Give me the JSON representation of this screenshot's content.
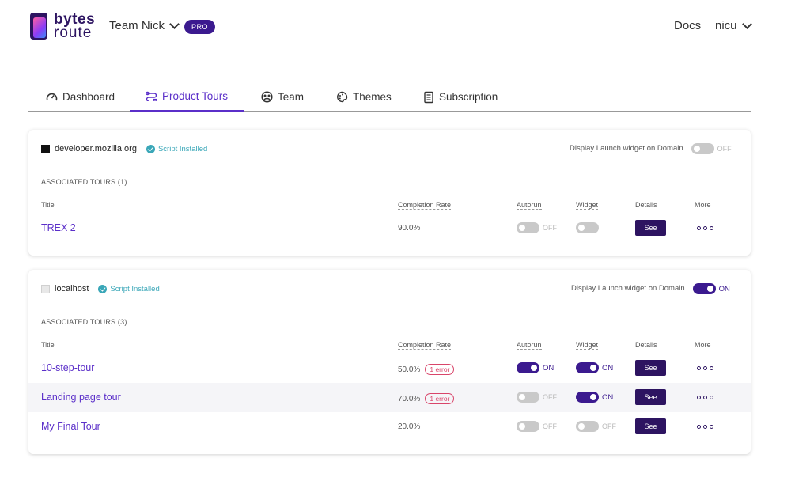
{
  "header": {
    "logo_top": "bytes",
    "logo_bottom": "route",
    "team": "Team Nick",
    "plan_badge": "PRO",
    "docs_link": "Docs",
    "user_name": "nicu"
  },
  "tabs": [
    {
      "label": "Dashboard",
      "icon": "gauge-icon"
    },
    {
      "label": "Product Tours",
      "icon": "route-icon",
      "active": true
    },
    {
      "label": "Team",
      "icon": "team-icon"
    },
    {
      "label": "Themes",
      "icon": "palette-icon"
    },
    {
      "label": "Subscription",
      "icon": "receipt-icon"
    }
  ],
  "table_headers": {
    "title": "Title",
    "completion_rate": "Completion Rate",
    "autorun": "Autorun",
    "widget": "Widget",
    "details": "Details",
    "more": "More"
  },
  "domains": [
    {
      "name": "developer.mozilla.org",
      "status": "Script Installed",
      "launch_label": "Display Launch widget on Domain",
      "launch_state": "OFF",
      "associated": "ASSOCIATED TOURS (1)",
      "tours": [
        {
          "title": "TREX 2",
          "rate": "90.0%",
          "error": "",
          "autorun": "OFF",
          "widget": "",
          "details": "See"
        }
      ]
    },
    {
      "name": "localhost",
      "status": "Script Installed",
      "launch_label": "Display Launch widget on Domain",
      "launch_state": "ON",
      "associated": "ASSOCIATED TOURS (3)",
      "tours": [
        {
          "title": "10-step-tour",
          "rate": "50.0%",
          "error": "1 error",
          "autorun": "ON",
          "widget": "ON",
          "details": "See"
        },
        {
          "title": "Landing page tour",
          "rate": "70.0%",
          "error": "1 error",
          "autorun": "OFF",
          "widget": "ON",
          "details": "See"
        },
        {
          "title": "My Final Tour",
          "rate": "20.0%",
          "error": "",
          "autorun": "OFF",
          "widget": "OFF",
          "details": "See"
        }
      ]
    }
  ],
  "colors": {
    "accent": "#5b2fc9",
    "brand_dark": "#2d1461",
    "installed": "#3aa7b8",
    "error": "#d9456a"
  }
}
